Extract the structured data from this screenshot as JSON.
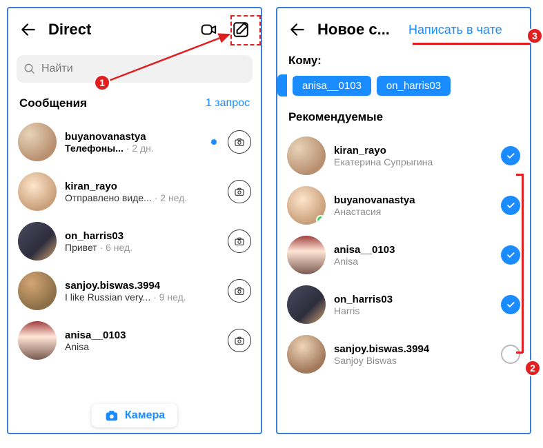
{
  "left": {
    "title": "Direct",
    "search_placeholder": "Найти",
    "section_title": "Сообщения",
    "requests_link": "1 запрос",
    "camera_label": "Камера",
    "items": [
      {
        "username": "buyanovanastya",
        "msg": "Телефоны...",
        "time": "2 дн.",
        "unread": true
      },
      {
        "username": "kiran_rayo",
        "msg": "Отправлено виде...",
        "time": "2 нед."
      },
      {
        "username": "on_harris03",
        "msg": "Привет",
        "time": "6 нед."
      },
      {
        "username": "sanjoy.biswas.3994",
        "msg": "I like Russian very...",
        "time": "9 нед."
      },
      {
        "username": "anisa__0103",
        "msg": "Anisa",
        "time": ""
      }
    ]
  },
  "right": {
    "title": "Новое с...",
    "action": "Написать в чате",
    "to_label": "Кому:",
    "chips": [
      "anisa__0103",
      "on_harris03"
    ],
    "rec_title": "Рекомендуемые",
    "items": [
      {
        "username": "kiran_rayo",
        "name": "Екатерина Супрыгина",
        "selected": true
      },
      {
        "username": "buyanovanastya",
        "name": "Анастасия",
        "selected": true,
        "online": true
      },
      {
        "username": "anisa__0103",
        "name": "Anisa",
        "selected": true
      },
      {
        "username": "on_harris03",
        "name": "Harris",
        "selected": true
      },
      {
        "username": "sanjoy.biswas.3994",
        "name": "Sanjoy Biswas",
        "selected": false
      }
    ]
  },
  "markers": {
    "m1": "1",
    "m2": "2",
    "m3": "3"
  }
}
